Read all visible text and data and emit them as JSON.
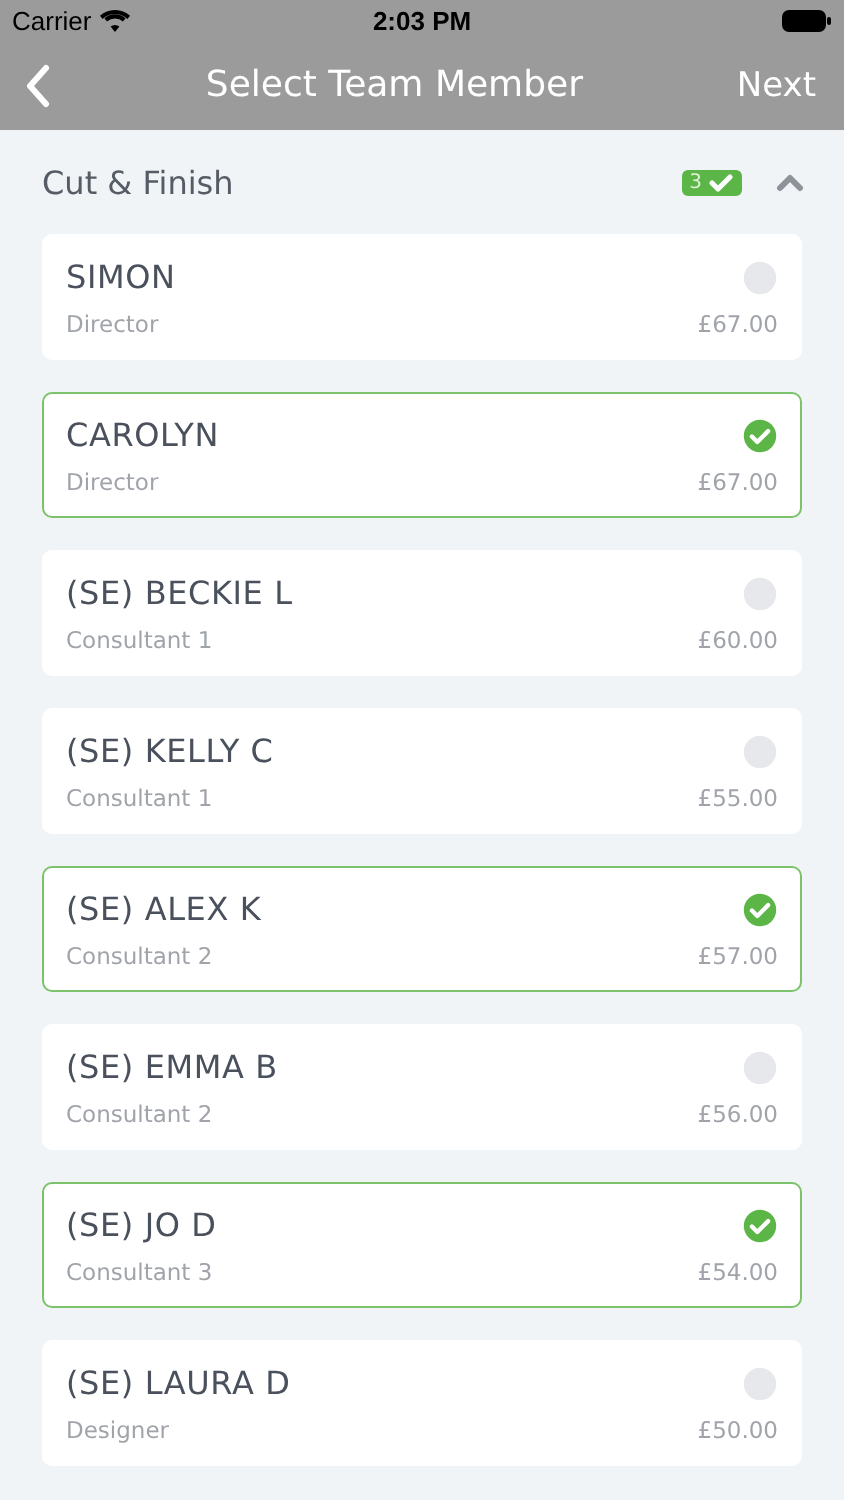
{
  "status_bar": {
    "carrier": "Carrier",
    "time": "2:03 PM"
  },
  "nav_bar": {
    "title": "Select Team Member",
    "action": "Next"
  },
  "section": {
    "title": "Cut & Finish",
    "count": "3",
    "expanded": true
  },
  "members": [
    {
      "name": "SIMON",
      "role": "Director",
      "price": "£67.00",
      "selected": false
    },
    {
      "name": "CAROLYN",
      "role": "Director",
      "price": "£67.00",
      "selected": true
    },
    {
      "name": "(SE) BECKIE L",
      "role": "Consultant 1",
      "price": "£60.00",
      "selected": false
    },
    {
      "name": "(SE) KELLY C",
      "role": "Consultant 1",
      "price": "£55.00",
      "selected": false
    },
    {
      "name": "(SE) ALEX K",
      "role": "Consultant 2",
      "price": "£57.00",
      "selected": true
    },
    {
      "name": "(SE) EMMA B",
      "role": "Consultant 2",
      "price": "£56.00",
      "selected": false
    },
    {
      "name": "(SE) JO D",
      "role": "Consultant 3",
      "price": "£54.00",
      "selected": true
    },
    {
      "name": "(SE) LAURA D",
      "role": "Designer",
      "price": "£50.00",
      "selected": false
    }
  ]
}
